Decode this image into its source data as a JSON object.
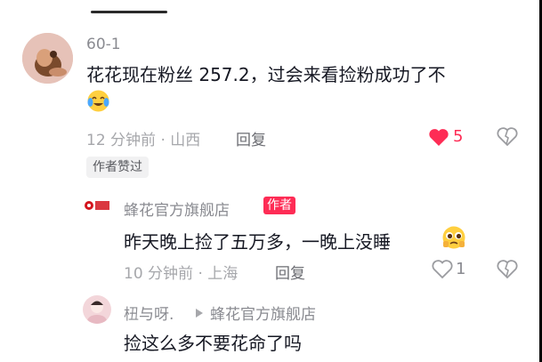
{
  "comments": [
    {
      "username": "60-1",
      "text": "花花现在粉丝 257.2，过会来看捡粉成功了不",
      "emoji": "cry-laugh-emoji",
      "time_location": "12 分钟前 · 山西",
      "reply_label": "回复",
      "like_count": "5",
      "liked": true,
      "author_liked_label": "作者赞过"
    },
    {
      "username": "蜂花官方旗舰店",
      "author_tag": "作者",
      "text": "昨天晚上捡了五万多，一晚上没睡",
      "emoji": "pleading-emoji",
      "time_location": "10 分钟前 · 上海",
      "reply_label": "回复",
      "like_count": "1",
      "liked": false
    },
    {
      "username": "杻与呀.",
      "reply_to": "蜂花官方旗舰店",
      "text": "捡这么多不要花命了吗"
    }
  ],
  "colors": {
    "accent": "#fe2c55",
    "meta": "#a6a7ab"
  }
}
